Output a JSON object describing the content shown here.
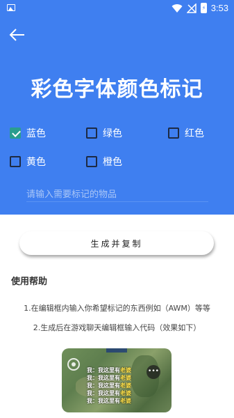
{
  "status_bar": {
    "time": "3:53",
    "icons": [
      "image-icon",
      "wifi-icon",
      "no-signal-icon",
      "battery-icon"
    ]
  },
  "header": {
    "title": "彩色字体颜色标记",
    "background_color": "#3f7ff0"
  },
  "options": [
    {
      "label": "蓝色",
      "checked": true
    },
    {
      "label": "绿色",
      "checked": false
    },
    {
      "label": "红色",
      "checked": false
    },
    {
      "label": "黄色",
      "checked": false
    },
    {
      "label": "橙色",
      "checked": false
    }
  ],
  "input": {
    "placeholder": "请输入需要标记的物品",
    "value": ""
  },
  "generate_button": {
    "label": "生成并复制"
  },
  "help": {
    "title": "使用帮助",
    "line1": "1.在编辑框内输入你希望标记的东西例如（AWM）等等",
    "line2": "2.生成后在游戏聊天编辑框输入代码（效果如下）"
  },
  "example_image": {
    "chat_lines": [
      {
        "prefix": "我：我这里有",
        "highlight": "老婆"
      },
      {
        "prefix": "我：我这里有",
        "highlight": "老婆"
      },
      {
        "prefix": "我：我这里有",
        "highlight": "老婆"
      },
      {
        "prefix": "我：我这里有",
        "highlight": "老婆"
      },
      {
        "prefix": "我：我这里有",
        "highlight": "老婆"
      }
    ]
  }
}
